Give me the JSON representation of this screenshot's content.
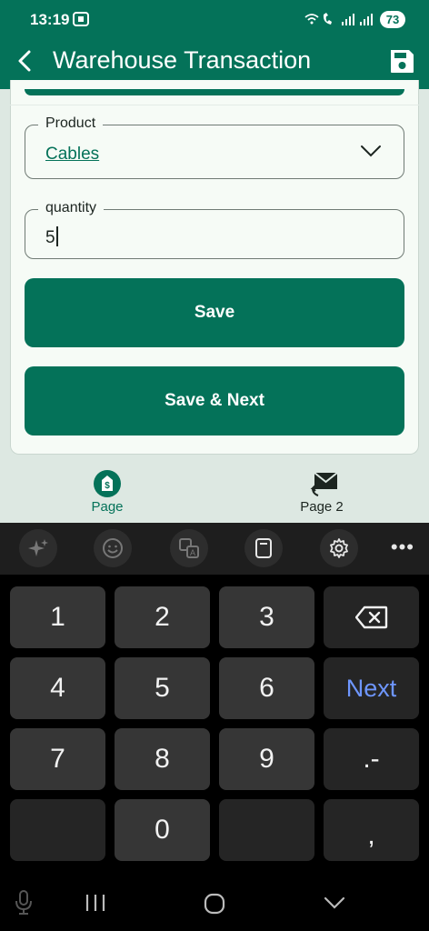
{
  "status_bar": {
    "time": "13:19",
    "battery": "73"
  },
  "app_bar": {
    "title": "Warehouse Transaction"
  },
  "form": {
    "product": {
      "label": "Product",
      "value": "Cables"
    },
    "quantity": {
      "label": "quantity",
      "value": "5"
    },
    "save_label": "Save",
    "save_next_label": "Save & Next"
  },
  "bottom_nav": [
    {
      "label": "Page",
      "icon": "dollar-circle-icon",
      "active": true
    },
    {
      "label": "Page 2",
      "icon": "mail-reply-icon",
      "active": false
    }
  ],
  "keyboard": {
    "rows": [
      [
        "1",
        "2",
        "3",
        "backspace"
      ],
      [
        "4",
        "5",
        "6",
        "Next"
      ],
      [
        "7",
        "8",
        "9",
        ".-"
      ],
      [
        "",
        "0",
        "",
        ","
      ]
    ],
    "next_label": "Next"
  },
  "colors": {
    "primary": "#047259",
    "background": "#dde8e2",
    "keyboard_accent": "#6e96ff"
  }
}
